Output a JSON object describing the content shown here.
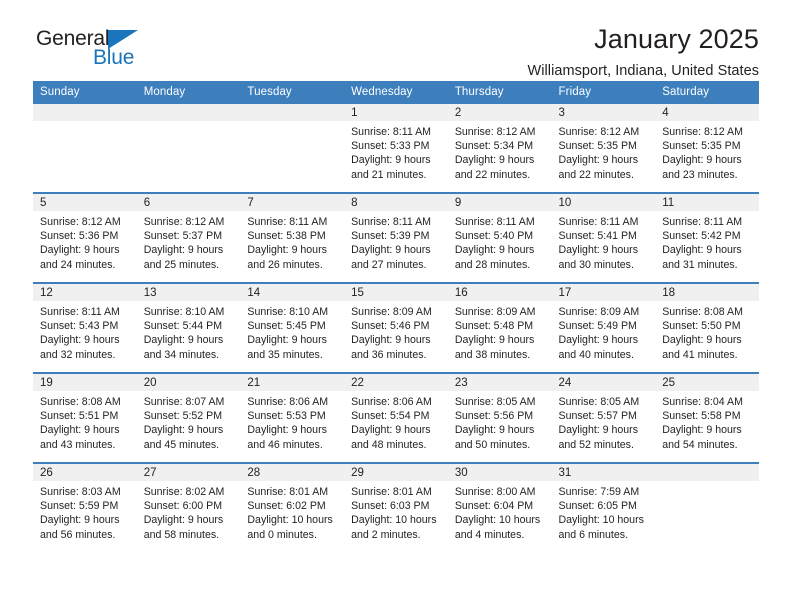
{
  "brand": {
    "name_part1": "General",
    "name_part2": "Blue",
    "triangle_color": "#1b75bc"
  },
  "header": {
    "title": "January 2025",
    "subtitle": "Williamsport, Indiana, United States"
  },
  "theme": {
    "header_blue": "#3d7ebd",
    "band_gray": "#f0f0f0",
    "text": "#231f20"
  },
  "weekday_headers": [
    "Sunday",
    "Monday",
    "Tuesday",
    "Wednesday",
    "Thursday",
    "Friday",
    "Saturday"
  ],
  "weeks": [
    [
      {
        "day": "",
        "sunrise": "",
        "sunset": "",
        "daylight_line1": "",
        "daylight_line2": ""
      },
      {
        "day": "",
        "sunrise": "",
        "sunset": "",
        "daylight_line1": "",
        "daylight_line2": ""
      },
      {
        "day": "",
        "sunrise": "",
        "sunset": "",
        "daylight_line1": "",
        "daylight_line2": ""
      },
      {
        "day": "1",
        "sunrise": "Sunrise: 8:11 AM",
        "sunset": "Sunset: 5:33 PM",
        "daylight_line1": "Daylight: 9 hours",
        "daylight_line2": "and 21 minutes."
      },
      {
        "day": "2",
        "sunrise": "Sunrise: 8:12 AM",
        "sunset": "Sunset: 5:34 PM",
        "daylight_line1": "Daylight: 9 hours",
        "daylight_line2": "and 22 minutes."
      },
      {
        "day": "3",
        "sunrise": "Sunrise: 8:12 AM",
        "sunset": "Sunset: 5:35 PM",
        "daylight_line1": "Daylight: 9 hours",
        "daylight_line2": "and 22 minutes."
      },
      {
        "day": "4",
        "sunrise": "Sunrise: 8:12 AM",
        "sunset": "Sunset: 5:35 PM",
        "daylight_line1": "Daylight: 9 hours",
        "daylight_line2": "and 23 minutes."
      }
    ],
    [
      {
        "day": "5",
        "sunrise": "Sunrise: 8:12 AM",
        "sunset": "Sunset: 5:36 PM",
        "daylight_line1": "Daylight: 9 hours",
        "daylight_line2": "and 24 minutes."
      },
      {
        "day": "6",
        "sunrise": "Sunrise: 8:12 AM",
        "sunset": "Sunset: 5:37 PM",
        "daylight_line1": "Daylight: 9 hours",
        "daylight_line2": "and 25 minutes."
      },
      {
        "day": "7",
        "sunrise": "Sunrise: 8:11 AM",
        "sunset": "Sunset: 5:38 PM",
        "daylight_line1": "Daylight: 9 hours",
        "daylight_line2": "and 26 minutes."
      },
      {
        "day": "8",
        "sunrise": "Sunrise: 8:11 AM",
        "sunset": "Sunset: 5:39 PM",
        "daylight_line1": "Daylight: 9 hours",
        "daylight_line2": "and 27 minutes."
      },
      {
        "day": "9",
        "sunrise": "Sunrise: 8:11 AM",
        "sunset": "Sunset: 5:40 PM",
        "daylight_line1": "Daylight: 9 hours",
        "daylight_line2": "and 28 minutes."
      },
      {
        "day": "10",
        "sunrise": "Sunrise: 8:11 AM",
        "sunset": "Sunset: 5:41 PM",
        "daylight_line1": "Daylight: 9 hours",
        "daylight_line2": "and 30 minutes."
      },
      {
        "day": "11",
        "sunrise": "Sunrise: 8:11 AM",
        "sunset": "Sunset: 5:42 PM",
        "daylight_line1": "Daylight: 9 hours",
        "daylight_line2": "and 31 minutes."
      }
    ],
    [
      {
        "day": "12",
        "sunrise": "Sunrise: 8:11 AM",
        "sunset": "Sunset: 5:43 PM",
        "daylight_line1": "Daylight: 9 hours",
        "daylight_line2": "and 32 minutes."
      },
      {
        "day": "13",
        "sunrise": "Sunrise: 8:10 AM",
        "sunset": "Sunset: 5:44 PM",
        "daylight_line1": "Daylight: 9 hours",
        "daylight_line2": "and 34 minutes."
      },
      {
        "day": "14",
        "sunrise": "Sunrise: 8:10 AM",
        "sunset": "Sunset: 5:45 PM",
        "daylight_line1": "Daylight: 9 hours",
        "daylight_line2": "and 35 minutes."
      },
      {
        "day": "15",
        "sunrise": "Sunrise: 8:09 AM",
        "sunset": "Sunset: 5:46 PM",
        "daylight_line1": "Daylight: 9 hours",
        "daylight_line2": "and 36 minutes."
      },
      {
        "day": "16",
        "sunrise": "Sunrise: 8:09 AM",
        "sunset": "Sunset: 5:48 PM",
        "daylight_line1": "Daylight: 9 hours",
        "daylight_line2": "and 38 minutes."
      },
      {
        "day": "17",
        "sunrise": "Sunrise: 8:09 AM",
        "sunset": "Sunset: 5:49 PM",
        "daylight_line1": "Daylight: 9 hours",
        "daylight_line2": "and 40 minutes."
      },
      {
        "day": "18",
        "sunrise": "Sunrise: 8:08 AM",
        "sunset": "Sunset: 5:50 PM",
        "daylight_line1": "Daylight: 9 hours",
        "daylight_line2": "and 41 minutes."
      }
    ],
    [
      {
        "day": "19",
        "sunrise": "Sunrise: 8:08 AM",
        "sunset": "Sunset: 5:51 PM",
        "daylight_line1": "Daylight: 9 hours",
        "daylight_line2": "and 43 minutes."
      },
      {
        "day": "20",
        "sunrise": "Sunrise: 8:07 AM",
        "sunset": "Sunset: 5:52 PM",
        "daylight_line1": "Daylight: 9 hours",
        "daylight_line2": "and 45 minutes."
      },
      {
        "day": "21",
        "sunrise": "Sunrise: 8:06 AM",
        "sunset": "Sunset: 5:53 PM",
        "daylight_line1": "Daylight: 9 hours",
        "daylight_line2": "and 46 minutes."
      },
      {
        "day": "22",
        "sunrise": "Sunrise: 8:06 AM",
        "sunset": "Sunset: 5:54 PM",
        "daylight_line1": "Daylight: 9 hours",
        "daylight_line2": "and 48 minutes."
      },
      {
        "day": "23",
        "sunrise": "Sunrise: 8:05 AM",
        "sunset": "Sunset: 5:56 PM",
        "daylight_line1": "Daylight: 9 hours",
        "daylight_line2": "and 50 minutes."
      },
      {
        "day": "24",
        "sunrise": "Sunrise: 8:05 AM",
        "sunset": "Sunset: 5:57 PM",
        "daylight_line1": "Daylight: 9 hours",
        "daylight_line2": "and 52 minutes."
      },
      {
        "day": "25",
        "sunrise": "Sunrise: 8:04 AM",
        "sunset": "Sunset: 5:58 PM",
        "daylight_line1": "Daylight: 9 hours",
        "daylight_line2": "and 54 minutes."
      }
    ],
    [
      {
        "day": "26",
        "sunrise": "Sunrise: 8:03 AM",
        "sunset": "Sunset: 5:59 PM",
        "daylight_line1": "Daylight: 9 hours",
        "daylight_line2": "and 56 minutes."
      },
      {
        "day": "27",
        "sunrise": "Sunrise: 8:02 AM",
        "sunset": "Sunset: 6:00 PM",
        "daylight_line1": "Daylight: 9 hours",
        "daylight_line2": "and 58 minutes."
      },
      {
        "day": "28",
        "sunrise": "Sunrise: 8:01 AM",
        "sunset": "Sunset: 6:02 PM",
        "daylight_line1": "Daylight: 10 hours",
        "daylight_line2": "and 0 minutes."
      },
      {
        "day": "29",
        "sunrise": "Sunrise: 8:01 AM",
        "sunset": "Sunset: 6:03 PM",
        "daylight_line1": "Daylight: 10 hours",
        "daylight_line2": "and 2 minutes."
      },
      {
        "day": "30",
        "sunrise": "Sunrise: 8:00 AM",
        "sunset": "Sunset: 6:04 PM",
        "daylight_line1": "Daylight: 10 hours",
        "daylight_line2": "and 4 minutes."
      },
      {
        "day": "31",
        "sunrise": "Sunrise: 7:59 AM",
        "sunset": "Sunset: 6:05 PM",
        "daylight_line1": "Daylight: 10 hours",
        "daylight_line2": "and 6 minutes."
      },
      {
        "day": "",
        "sunrise": "",
        "sunset": "",
        "daylight_line1": "",
        "daylight_line2": ""
      }
    ]
  ]
}
